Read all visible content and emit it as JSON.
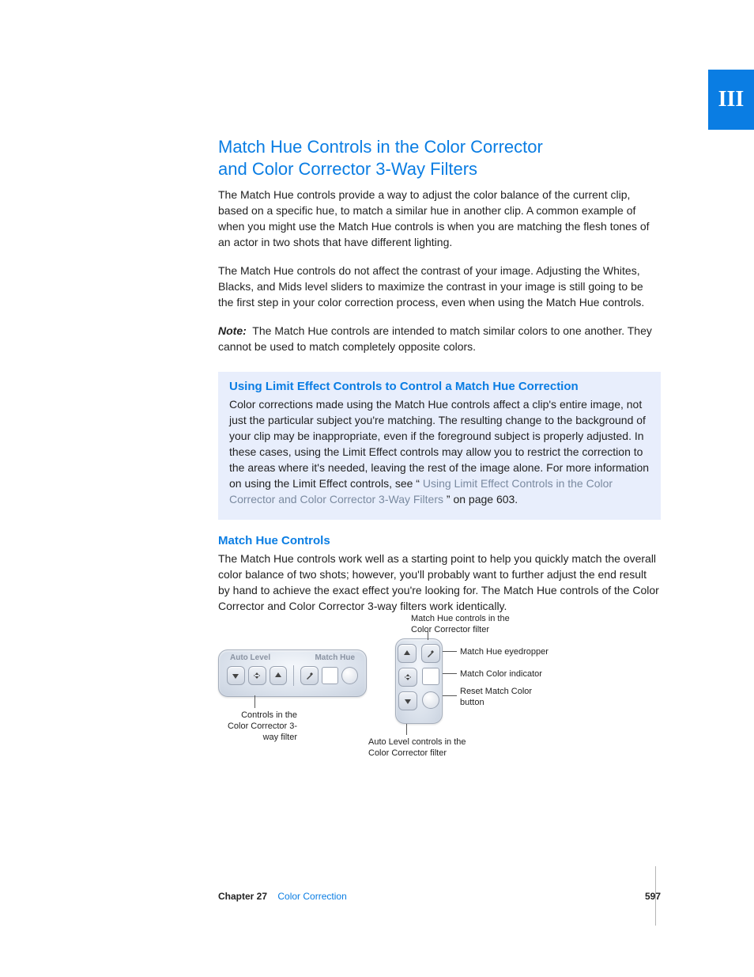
{
  "part_tab": "III",
  "title_line1": "Match Hue Controls in the Color Corrector",
  "title_line2": "and Color Corrector 3-Way Filters",
  "p1": "The Match Hue controls provide a way to adjust the color balance of the current clip, based on a specific hue, to match a similar hue in another clip. A common example of when you might use the Match Hue controls is when you are matching the flesh tones of an actor in two shots that have different lighting.",
  "p2": "The Match Hue controls do not affect the contrast of your image. Adjusting the Whites, Blacks, and Mids level sliders to maximize the contrast in your image is still going to be the first step in your color correction process, even when using the Match Hue controls.",
  "note_label": "Note:",
  "note_text": " The Match Hue controls are intended to match similar colors to one another. They cannot be used to match completely opposite colors.",
  "box": {
    "title": "Using Limit Effect Controls to Control a Match Hue Correction",
    "text_before": "Color corrections made using the Match Hue controls affect a clip's entire image, not just the particular subject you're matching. The resulting change to the background of your clip may be inappropriate, even if the foreground subject is properly adjusted. In these cases, using the Limit Effect controls may allow you to restrict the correction to the areas where it's needed, leaving the rest of the image alone. For more information on using the Limit Effect controls, see “",
    "link": "Using Limit Effect Controls in the Color Corrector and Color Corrector 3-Way Filters",
    "text_after": "” on page 603."
  },
  "sub2_title": "Match Hue Controls",
  "sub2_p": "The Match Hue controls work well as a starting point to help you quickly match the overall color balance of two shots; however, you'll probably want to further adjust the end result by hand to achieve the exact effect you're looking for. The Match Hue controls of the Color Corrector and Color Corrector 3-way filters work identically.",
  "fig": {
    "top_center": "Match Hue controls in the Color Corrector filter",
    "panelA": {
      "left_label": "Auto Level",
      "right_label": "Match Hue"
    },
    "left_caption": "Controls in the Color Corrector 3-way filter",
    "r1": "Match Hue eyedropper",
    "r2": "Match Color indicator",
    "r3": "Reset Match Color button",
    "bottom": "Auto Level controls in the Color Corrector filter"
  },
  "footer": {
    "chapter": "Chapter 27",
    "title": "Color Correction",
    "page": "597"
  }
}
